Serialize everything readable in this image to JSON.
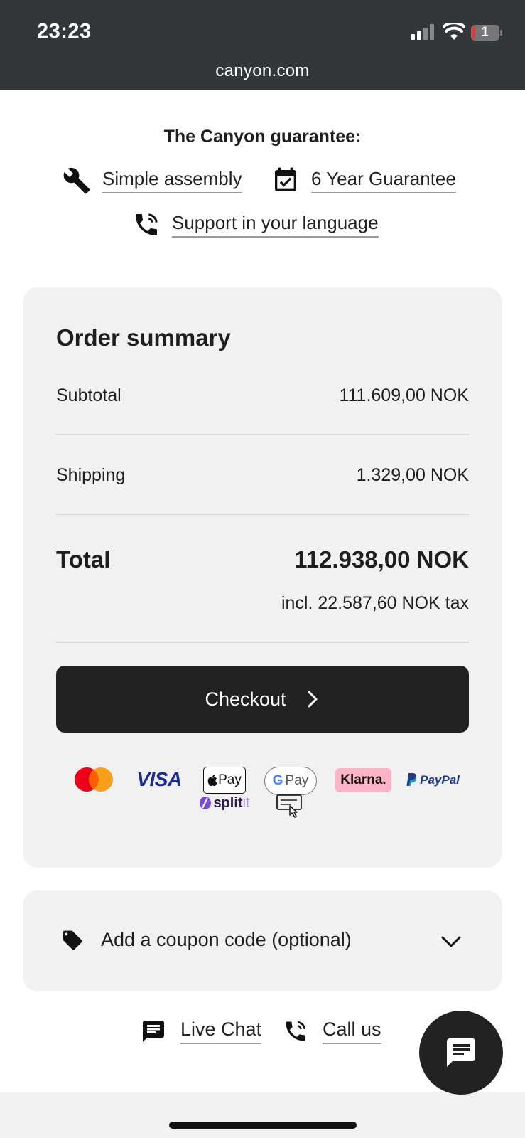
{
  "status_bar": {
    "time": "23:23",
    "battery_level": "1",
    "url": "canyon.com"
  },
  "guarantee": {
    "title": "The Canyon guarantee:",
    "items": [
      {
        "label": "Simple assembly",
        "icon": "wrench-icon"
      },
      {
        "label": "6 Year Guarantee",
        "icon": "calendar-check-icon"
      },
      {
        "label": "Support in your language",
        "icon": "phone-icon"
      }
    ]
  },
  "order_summary": {
    "title": "Order summary",
    "subtotal_label": "Subtotal",
    "subtotal_value": "111.609,00 NOK",
    "shipping_label": "Shipping",
    "shipping_value": "1.329,00 NOK",
    "total_label": "Total",
    "total_value": "112.938,00 NOK",
    "tax_note": "incl. 22.587,60 NOK tax",
    "checkout_label": "Checkout"
  },
  "payment_methods": {
    "visa": "VISA",
    "apple_pay": "Pay",
    "google_pay_g": "G",
    "google_pay": "Pay",
    "klarna": "Klarna.",
    "paypal": "PayPal",
    "splitit_a": "split",
    "splitit_b": "it"
  },
  "coupon": {
    "label": "Add a coupon code (optional)"
  },
  "footer": {
    "live_chat": "Live Chat",
    "call_us": "Call us"
  },
  "colors": {
    "status_bar_bg": "#34373a",
    "card_bg": "#f1f1f1",
    "checkout_bg": "#222222",
    "klarna_pink": "#ffb3c7",
    "visa_blue": "#1a2b8f"
  }
}
